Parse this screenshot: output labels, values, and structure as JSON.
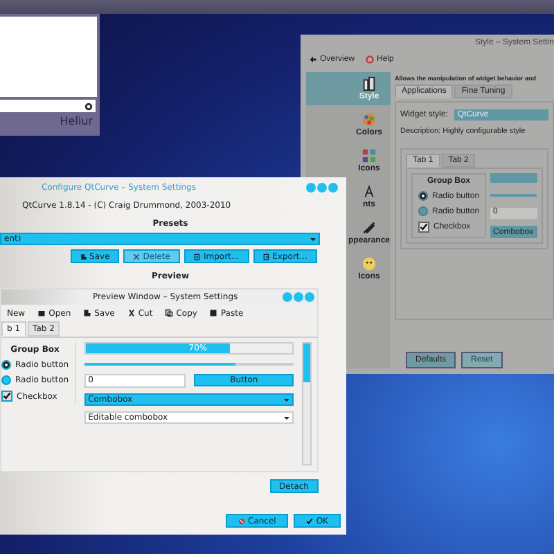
{
  "back_window": {
    "label": "Heliur"
  },
  "style_window": {
    "title": "Style – System Settin",
    "toolbar": [
      {
        "label": "Overview"
      },
      {
        "label": "Help"
      }
    ],
    "sidebar": [
      {
        "label": "Style",
        "selected": true
      },
      {
        "label": "Colors",
        "selected": false
      },
      {
        "label": "Icons",
        "selected": false
      },
      {
        "label": "nts",
        "selected": false
      },
      {
        "label": "ppearance",
        "selected": false
      },
      {
        "label": "Icons",
        "selected": false
      }
    ],
    "header": "Allows the manipulation of widget behavior and",
    "tabs": [
      {
        "label": "Applications",
        "selected": true
      },
      {
        "label": "Fine Tuning",
        "selected": false
      }
    ],
    "widget_style_label": "Widget style:",
    "widget_style_value": "QtCurve",
    "description": "Description: Highly configurable style",
    "preview": {
      "tabs": [
        {
          "label": "Tab 1",
          "selected": true
        },
        {
          "label": "Tab 2",
          "selected": false
        }
      ],
      "group_title": "Group Box",
      "radios": [
        {
          "label": "Radio button",
          "selected": true
        },
        {
          "label": "Radio button",
          "selected": false
        }
      ],
      "checkbox": {
        "label": "Checkbox",
        "checked": true
      },
      "progress": {
        "level": 1
      },
      "slider": {
        "level": 0.97
      },
      "spin_value": "0",
      "combobox": "Combobox"
    },
    "buttons": [
      {
        "label": "Defaults",
        "disabled": false
      },
      {
        "label": "Reset",
        "disabled": true
      }
    ]
  },
  "dialog": {
    "title": "Configure QtCurve – System Settings",
    "about": "QtCurve 1.8.14 - (C) Craig Drummond, 2003-2010",
    "presets_label": "Presets",
    "preset_value": "ent)",
    "preset_buttons": [
      {
        "label": "Save",
        "disabled": false
      },
      {
        "label": "Delete",
        "disabled": true
      },
      {
        "label": "Import...",
        "disabled": false
      },
      {
        "label": "Export...",
        "disabled": false
      }
    ],
    "preview_label": "Preview",
    "preview_window": {
      "title": "Preview Window – System Settings",
      "toolbar": [
        {
          "label": "New"
        },
        {
          "label": "Open"
        },
        {
          "label": "Save"
        },
        {
          "label": "Cut"
        },
        {
          "label": "Copy"
        },
        {
          "label": "Paste"
        }
      ],
      "tabs": [
        {
          "label": "b 1",
          "selected": true
        },
        {
          "label": "Tab 2",
          "selected": false
        }
      ],
      "group_title": "Group Box",
      "radios": [
        {
          "label": "Radio button",
          "selected": true
        },
        {
          "label": "Radio button",
          "selected": false
        }
      ],
      "checkbox": {
        "label": "Checkbox",
        "checked": true
      },
      "progress": {
        "level": 0.7,
        "text": "70%"
      },
      "slider": {
        "level": 0.72
      },
      "spin_value": "0",
      "button": "Button",
      "combobox": "Combobox",
      "editable_combobox": "Editable combobox"
    },
    "detach": "Detach",
    "buttons": [
      {
        "label": "Cancel"
      },
      {
        "label": "OK"
      }
    ]
  }
}
